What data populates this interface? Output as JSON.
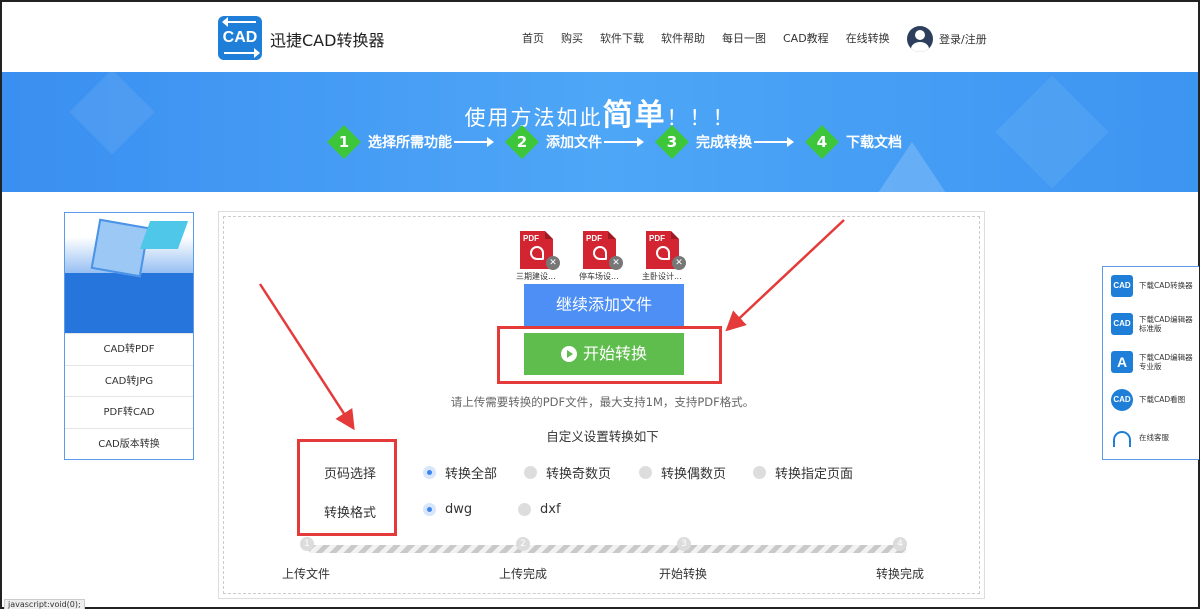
{
  "header": {
    "logo_text": "CAD",
    "brand": "迅捷CAD转换器",
    "nav": [
      "首页",
      "购买",
      "软件下载",
      "软件帮助",
      "每日一图",
      "CAD教程",
      "在线转换"
    ],
    "login": "登录/注册"
  },
  "banner": {
    "title_prefix": "使用方法如此",
    "title_big": "简单",
    "title_suffix": "！！！",
    "steps": [
      {
        "num": "1",
        "label": "选择所需功能"
      },
      {
        "num": "2",
        "label": "添加文件"
      },
      {
        "num": "3",
        "label": "完成转换"
      },
      {
        "num": "4",
        "label": "下载文档"
      }
    ]
  },
  "left_menu": [
    "CAD转PDF",
    "CAD转JPG",
    "PDF转CAD",
    "CAD版本转换"
  ],
  "files": [
    {
      "type": "PDF",
      "name": "三期建设..."
    },
    {
      "type": "PDF",
      "name": "停车场设..."
    },
    {
      "type": "PDF",
      "name": "主卧设计..."
    }
  ],
  "buttons": {
    "add_more": "继续添加文件",
    "start": "开始转换"
  },
  "tip": "请上传需要转换的PDF文件，最大支持1M，支持PDF格式。",
  "custom_title": "自定义设置转换如下",
  "page_select": {
    "label": "页码选择",
    "options": [
      "转换全部",
      "转换奇数页",
      "转换偶数页",
      "转换指定页面"
    ],
    "selected": "转换全部"
  },
  "format": {
    "label": "转换格式",
    "options": [
      "dwg",
      "dxf"
    ],
    "selected": "dwg"
  },
  "progress": {
    "nodes": [
      "1",
      "2",
      "3",
      "4"
    ],
    "labels": [
      "上传文件",
      "上传完成",
      "开始转换",
      "转换完成"
    ]
  },
  "right_menu": [
    {
      "icon": "CAD",
      "label": "下载CAD转换器"
    },
    {
      "icon": "CAD",
      "label": "下载CAD编辑器标准版"
    },
    {
      "icon": "A",
      "label": "下载CAD编辑器专业版"
    },
    {
      "icon": "CAD",
      "label": "下载CAD看图"
    },
    {
      "icon": "headset",
      "label": "在线客服"
    }
  ],
  "status_bar": "javascript:void(0);",
  "colors": {
    "primary_blue": "#4d8ff5",
    "start_green": "#5fbd4e",
    "annotation_red": "#e43a3a",
    "step_green": "#3ec63a"
  }
}
